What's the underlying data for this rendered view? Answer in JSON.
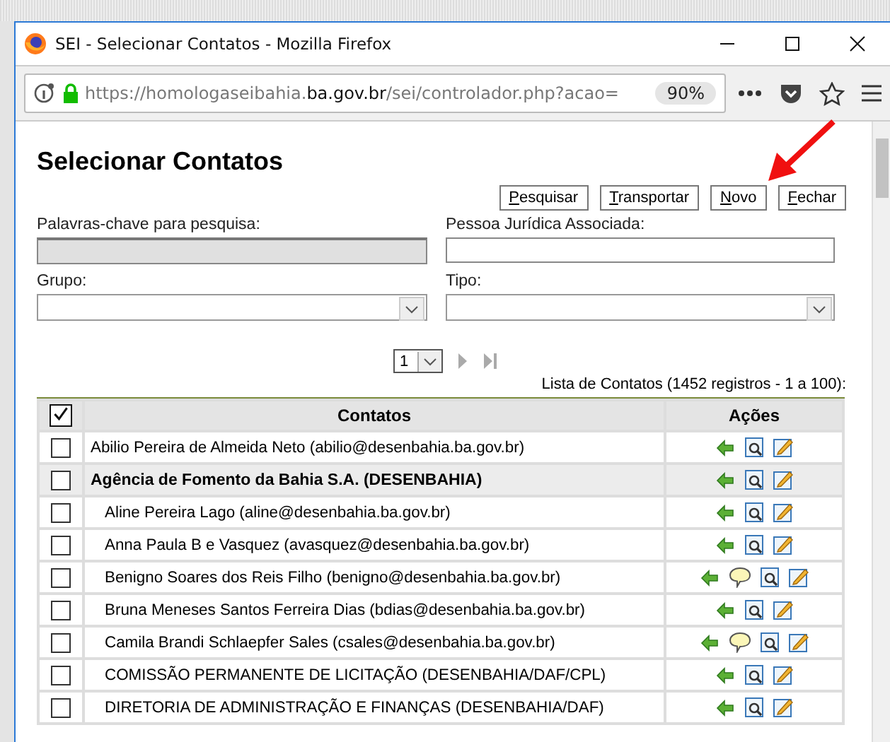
{
  "window": {
    "title": "SEI - Selecionar Contatos - Mozilla Firefox"
  },
  "address_bar": {
    "url_prefix": "https://homologaseibahia.",
    "url_domain": "ba.gov.br",
    "url_rest": "/sei/controlador.php?acao=",
    "zoom": "90%"
  },
  "page": {
    "title": "Selecionar Contatos",
    "buttons": [
      {
        "label": "Pesquisar"
      },
      {
        "label": "Transportar"
      },
      {
        "label": "Novo"
      },
      {
        "label": "Fechar"
      }
    ],
    "fields": [
      {
        "label": "Palavras-chave para pesquisa:",
        "kind": "text",
        "focused": true
      },
      {
        "label": "Pessoa Jurídica Associada:",
        "kind": "text",
        "focused": false
      },
      {
        "label": "Grupo:",
        "kind": "select"
      },
      {
        "label": "Tipo:",
        "kind": "select"
      }
    ],
    "pager": {
      "page": "1"
    },
    "caption": "Lista de Contatos (1452 registros - 1 a 100):",
    "table": {
      "columns": [
        "Contatos",
        "Ações"
      ],
      "select_all_checked": true,
      "rows": [
        {
          "name": "Abilio Pereira de Almeida Neto (abilio@desenbahia.ba.gov.br)",
          "checked": false,
          "actions": [
            {
              "kind": "transport"
            },
            {
              "kind": "view"
            },
            {
              "kind": "edit"
            }
          ]
        },
        {
          "name": "Agência de Fomento da Bahia S.A. (DESENBAHIA)",
          "checked": false,
          "actions": [
            {
              "kind": "transport"
            },
            {
              "kind": "view"
            },
            {
              "kind": "edit"
            }
          ],
          "children": [
            {
              "name": "Aline Pereira Lago (aline@desenbahia.ba.gov.br)",
              "checked": false,
              "actions": [
                {
                  "kind": "transport"
                },
                {
                  "kind": "view"
                },
                {
                  "kind": "edit"
                }
              ]
            },
            {
              "name": "Anna Paula B e Vasquez (avasquez@desenbahia.ba.gov.br)",
              "checked": false,
              "actions": [
                {
                  "kind": "transport"
                },
                {
                  "kind": "view"
                },
                {
                  "kind": "edit"
                }
              ]
            },
            {
              "name": "Benigno Soares dos Reis Filho (benigno@desenbahia.ba.gov.br)",
              "checked": false,
              "actions": [
                {
                  "kind": "transport"
                },
                {
                  "kind": "note"
                },
                {
                  "kind": "view"
                },
                {
                  "kind": "edit"
                }
              ]
            },
            {
              "name": "Bruna Meneses Santos Ferreira Dias (bdias@desenbahia.ba.gov.br)",
              "checked": false,
              "actions": [
                {
                  "kind": "transport"
                },
                {
                  "kind": "view"
                },
                {
                  "kind": "edit"
                }
              ]
            },
            {
              "name": "Camila Brandi Schlaepfer Sales (csales@desenbahia.ba.gov.br)",
              "checked": false,
              "actions": [
                {
                  "kind": "transport"
                },
                {
                  "kind": "note"
                },
                {
                  "kind": "view"
                },
                {
                  "kind": "edit"
                }
              ]
            },
            {
              "name": "COMISSÃO PERMANENTE DE LICITAÇÃO (DESENBAHIA/DAF/CPL)",
              "checked": false,
              "actions": [
                {
                  "kind": "transport"
                },
                {
                  "kind": "view"
                },
                {
                  "kind": "edit"
                }
              ]
            },
            {
              "name": "DIRETORIA DE ADMINISTRAÇÃO E FINANÇAS (DESENBAHIA/DAF)",
              "checked": false,
              "actions": [
                {
                  "kind": "transport"
                },
                {
                  "kind": "view"
                },
                {
                  "kind": "edit"
                }
              ]
            }
          ]
        }
      ]
    }
  }
}
